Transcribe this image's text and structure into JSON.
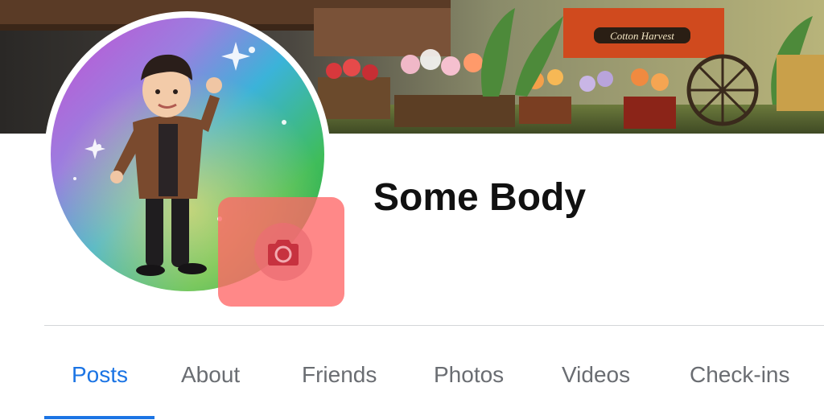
{
  "profile": {
    "name": "Some Body"
  },
  "cover": {
    "shop_sign": "Cotton Harvest"
  },
  "tabs": [
    {
      "label": "Posts",
      "active": true
    },
    {
      "label": "About",
      "active": false
    },
    {
      "label": "Friends",
      "active": false
    },
    {
      "label": "Photos",
      "active": false
    },
    {
      "label": "Videos",
      "active": false
    },
    {
      "label": "Check-ins",
      "active": false
    }
  ],
  "icons": {
    "camera": "camera-icon"
  },
  "colors": {
    "accent": "#1b74e4",
    "highlight": "#ff6666",
    "tab_inactive": "#6a6d72"
  }
}
